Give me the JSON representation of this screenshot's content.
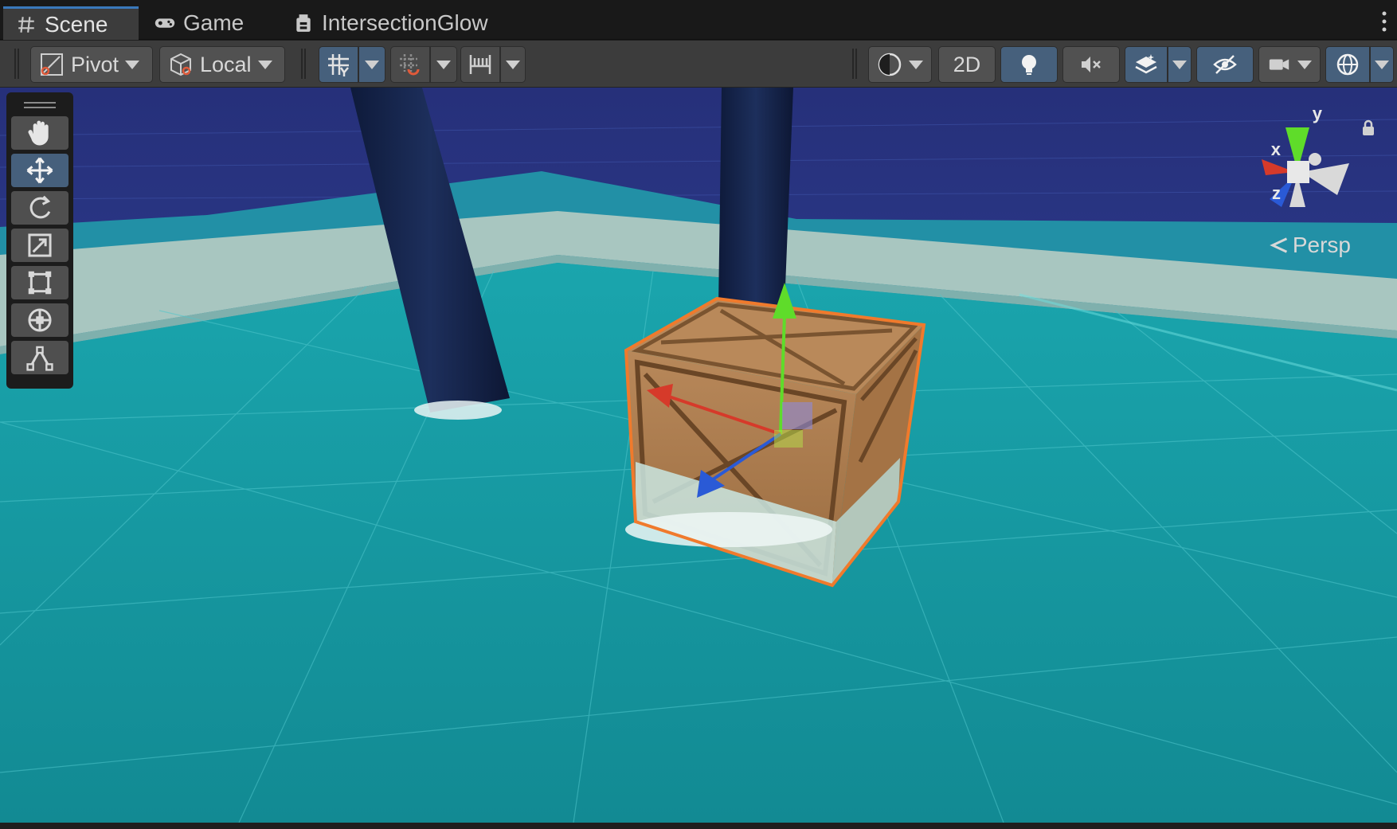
{
  "tabs": [
    {
      "label": "Scene",
      "icon": "hash-icon",
      "active": true
    },
    {
      "label": "Game",
      "icon": "gamepad-icon",
      "active": false
    },
    {
      "label": "IntersectionGlow",
      "icon": "film-icon",
      "active": false
    }
  ],
  "toolbar": {
    "pivot_label": "Pivot",
    "local_label": "Local",
    "mode_2d_label": "2D"
  },
  "gizmo": {
    "x_label": "x",
    "y_label": "y",
    "z_label": "z",
    "projection_label": "Persp"
  },
  "colors": {
    "accent": "#46607c",
    "selection_outline": "#f07a2c",
    "axis_x": "#d63a2a",
    "axis_y": "#5fdc2a",
    "axis_z": "#2a5ad6",
    "water": "#1c8f98"
  },
  "tools": [
    {
      "name": "hand-tool",
      "icon": "hand-icon",
      "active": false
    },
    {
      "name": "move-tool",
      "icon": "move-icon",
      "active": true
    },
    {
      "name": "rotate-tool",
      "icon": "rotate-icon",
      "active": false
    },
    {
      "name": "scale-tool",
      "icon": "scale-icon",
      "active": false
    },
    {
      "name": "rect-tool",
      "icon": "rect-icon",
      "active": false
    },
    {
      "name": "transform-tool",
      "icon": "transform-icon",
      "active": false
    },
    {
      "name": "custom-tool",
      "icon": "custom-tool-icon",
      "active": false
    }
  ]
}
